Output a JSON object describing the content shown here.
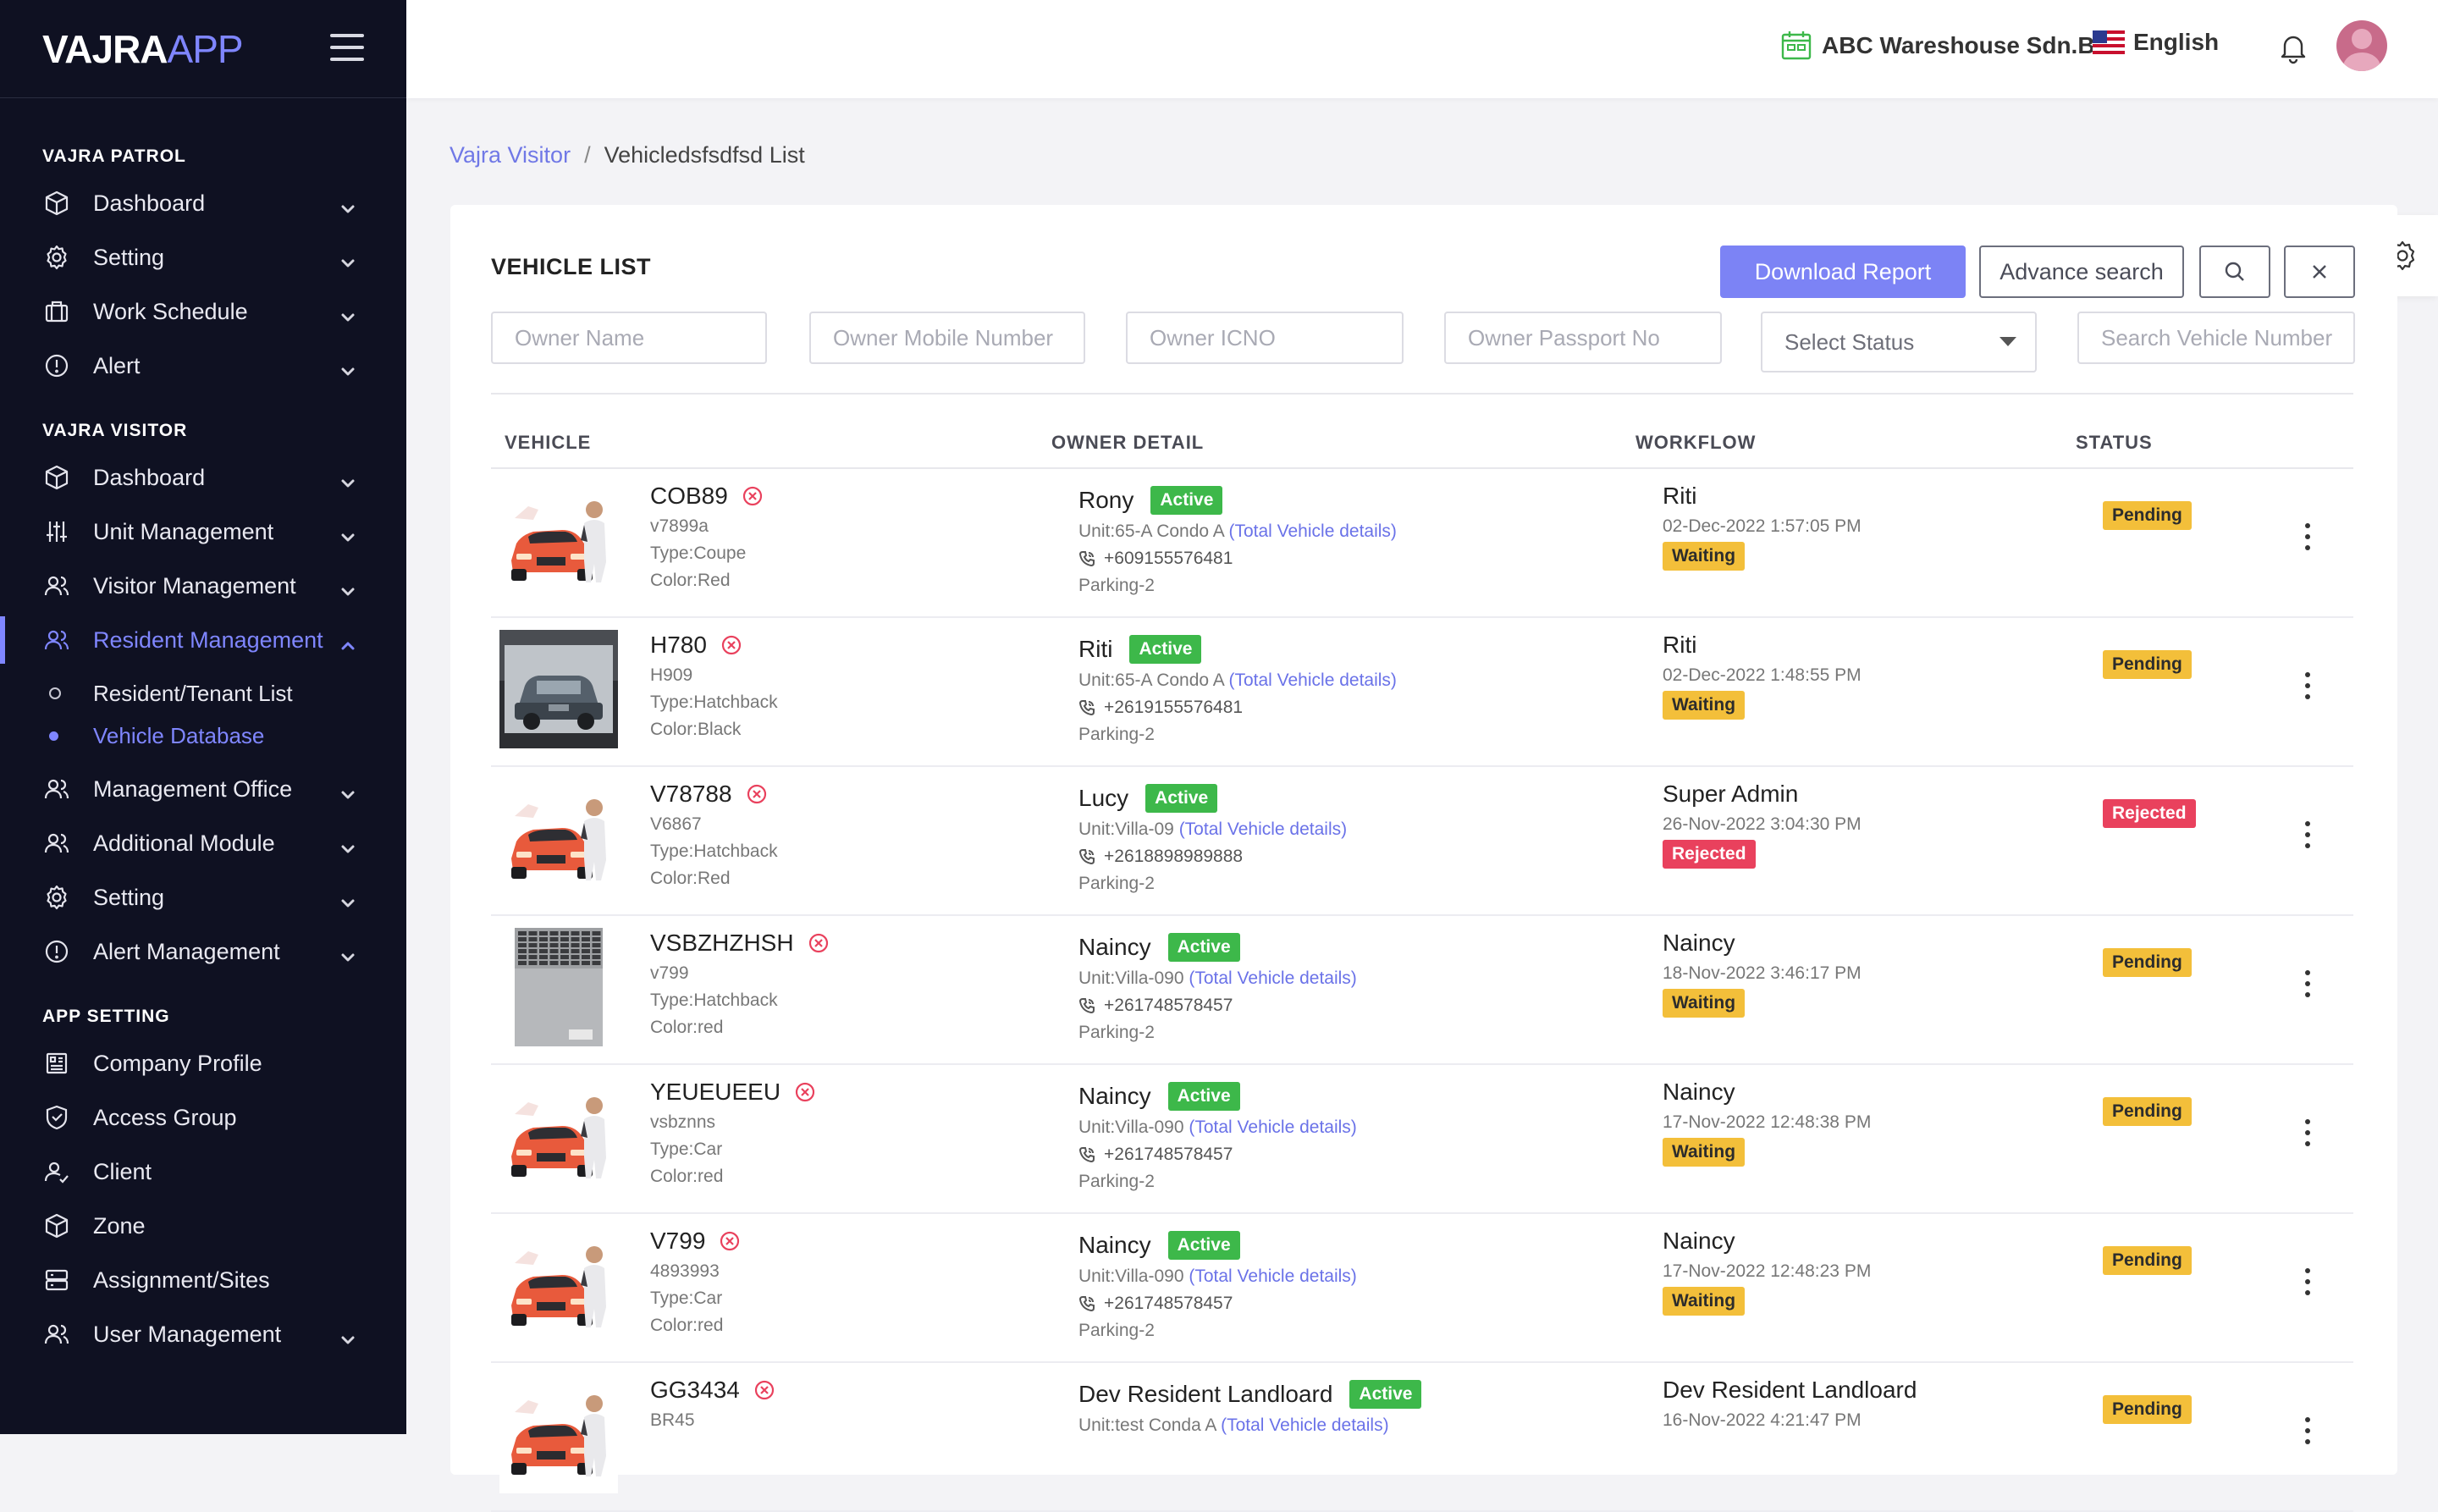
{
  "brand": {
    "main": "VAJRA",
    "sub": "APP"
  },
  "sidebar": {
    "sections": [
      {
        "title": "VAJRA PATROL"
      },
      {
        "title": "VAJRA VISITOR"
      },
      {
        "title": "APP SETTING"
      }
    ],
    "patrol_items": [
      "Dashboard",
      "Setting",
      "Work Schedule",
      "Alert"
    ],
    "visitor_items": [
      "Dashboard",
      "Unit Management",
      "Visitor Management",
      "Resident Management",
      "Management Office",
      "Additional Module",
      "Setting",
      "Alert Management"
    ],
    "resident_sub": [
      "Resident/Tenant List",
      "Vehicle Database"
    ],
    "app_items": [
      "Company Profile",
      "Access Group",
      "Client",
      "Zone",
      "Assignment/Sites",
      "User Management"
    ]
  },
  "topbar": {
    "company": "ABC Wareshouse Sdn.Bhd",
    "language": "English"
  },
  "breadcrumb": {
    "parent": "Vajra Visitor",
    "separator": "/",
    "current": "Vehicledsfsdfsd List"
  },
  "card": {
    "title": "VEHICLE LIST",
    "download_label": "Download Report",
    "advance_label": "Advance search"
  },
  "filters": {
    "owner_name": "Owner Name",
    "owner_mobile": "Owner Mobile Number",
    "owner_icno": "Owner ICNO",
    "owner_passport": "Owner Passport No",
    "status": "Select Status",
    "vehicle_number": "Search Vehicle Number"
  },
  "table": {
    "headers": {
      "vehicle": "VEHICLE",
      "owner": "OWNER DETAIL",
      "workflow": "WORKFLOW",
      "status": "STATUS"
    },
    "rows": [
      {
        "plate": "COB89",
        "code": "v7899a",
        "type": "Type:Coupe",
        "color": "Color:Red",
        "image": "red-car",
        "owner": "Rony",
        "owner_status": "Active",
        "unit": "Unit:65-A Condo A",
        "total_link": "(Total Vehicle details)",
        "phone": "+609155576481",
        "parking": "Parking-2",
        "wf_name": "Riti",
        "wf_date": "02-Dec-2022 1:57:05 PM",
        "wf_status": "Waiting",
        "status": "Pending"
      },
      {
        "plate": "H780",
        "code": "H909",
        "type": "Type:Hatchback",
        "color": "Color:Black",
        "image": "suv-photo",
        "owner": "Riti",
        "owner_status": "Active",
        "unit": "Unit:65-A Condo A",
        "total_link": "(Total Vehicle details)",
        "phone": "+2619155576481",
        "parking": "Parking-2",
        "wf_name": "Riti",
        "wf_date": "02-Dec-2022 1:48:55 PM",
        "wf_status": "Waiting",
        "status": "Pending"
      },
      {
        "plate": "V78788",
        "code": "V6867",
        "type": "Type:Hatchback",
        "color": "Color:Red",
        "image": "red-car",
        "owner": "Lucy",
        "owner_status": "Active",
        "unit": "Unit:Villa-09",
        "total_link": "(Total Vehicle details)",
        "phone": "+2618898989888",
        "parking": "Parking-2",
        "wf_name": "Super Admin",
        "wf_date": "26-Nov-2022 3:04:30 PM",
        "wf_status": "Rejected",
        "status": "Rejected"
      },
      {
        "plate": "VSBZHZHSH",
        "code": "v799",
        "type": "Type:Hatchback",
        "color": "Color:red",
        "image": "laptop-photo",
        "owner": "Naincy",
        "owner_status": "Active",
        "unit": "Unit:Villa-090",
        "total_link": "(Total Vehicle details)",
        "phone": "+261748578457",
        "parking": "Parking-2",
        "wf_name": "Naincy",
        "wf_date": "18-Nov-2022 3:46:17 PM",
        "wf_status": "Waiting",
        "status": "Pending"
      },
      {
        "plate": "YEUEUEEU",
        "code": "vsbznns",
        "type": "Type:Car",
        "color": "Color:red",
        "image": "red-car",
        "owner": "Naincy",
        "owner_status": "Active",
        "unit": "Unit:Villa-090",
        "total_link": "(Total Vehicle details)",
        "phone": "+261748578457",
        "parking": "Parking-2",
        "wf_name": "Naincy",
        "wf_date": "17-Nov-2022 12:48:38 PM",
        "wf_status": "Waiting",
        "status": "Pending"
      },
      {
        "plate": "V799",
        "code": "4893993",
        "type": "Type:Car",
        "color": "Color:red",
        "image": "red-car",
        "owner": "Naincy",
        "owner_status": "Active",
        "unit": "Unit:Villa-090",
        "total_link": "(Total Vehicle details)",
        "phone": "+261748578457",
        "parking": "Parking-2",
        "wf_name": "Naincy",
        "wf_date": "17-Nov-2022 12:48:23 PM",
        "wf_status": "Waiting",
        "status": "Pending"
      },
      {
        "plate": "GG3434",
        "code": "BR45",
        "type": "",
        "color": "",
        "image": "red-car",
        "owner": "Dev Resident Landloard",
        "owner_status": "Active",
        "unit": "Unit:test Conda A",
        "total_link": "(Total Vehicle details)",
        "phone": "",
        "parking": "",
        "wf_name": "Dev Resident Landloard",
        "wf_date": "16-Nov-2022 4:21:47 PM",
        "wf_status": "",
        "status": "Pending"
      }
    ]
  },
  "colors": {
    "accent": "#7c83f5",
    "sidebar_bg": "#0f1122",
    "active_green": "#3db84a",
    "pending_yellow": "#f3bf3a",
    "rejected_red": "#e9415d"
  }
}
